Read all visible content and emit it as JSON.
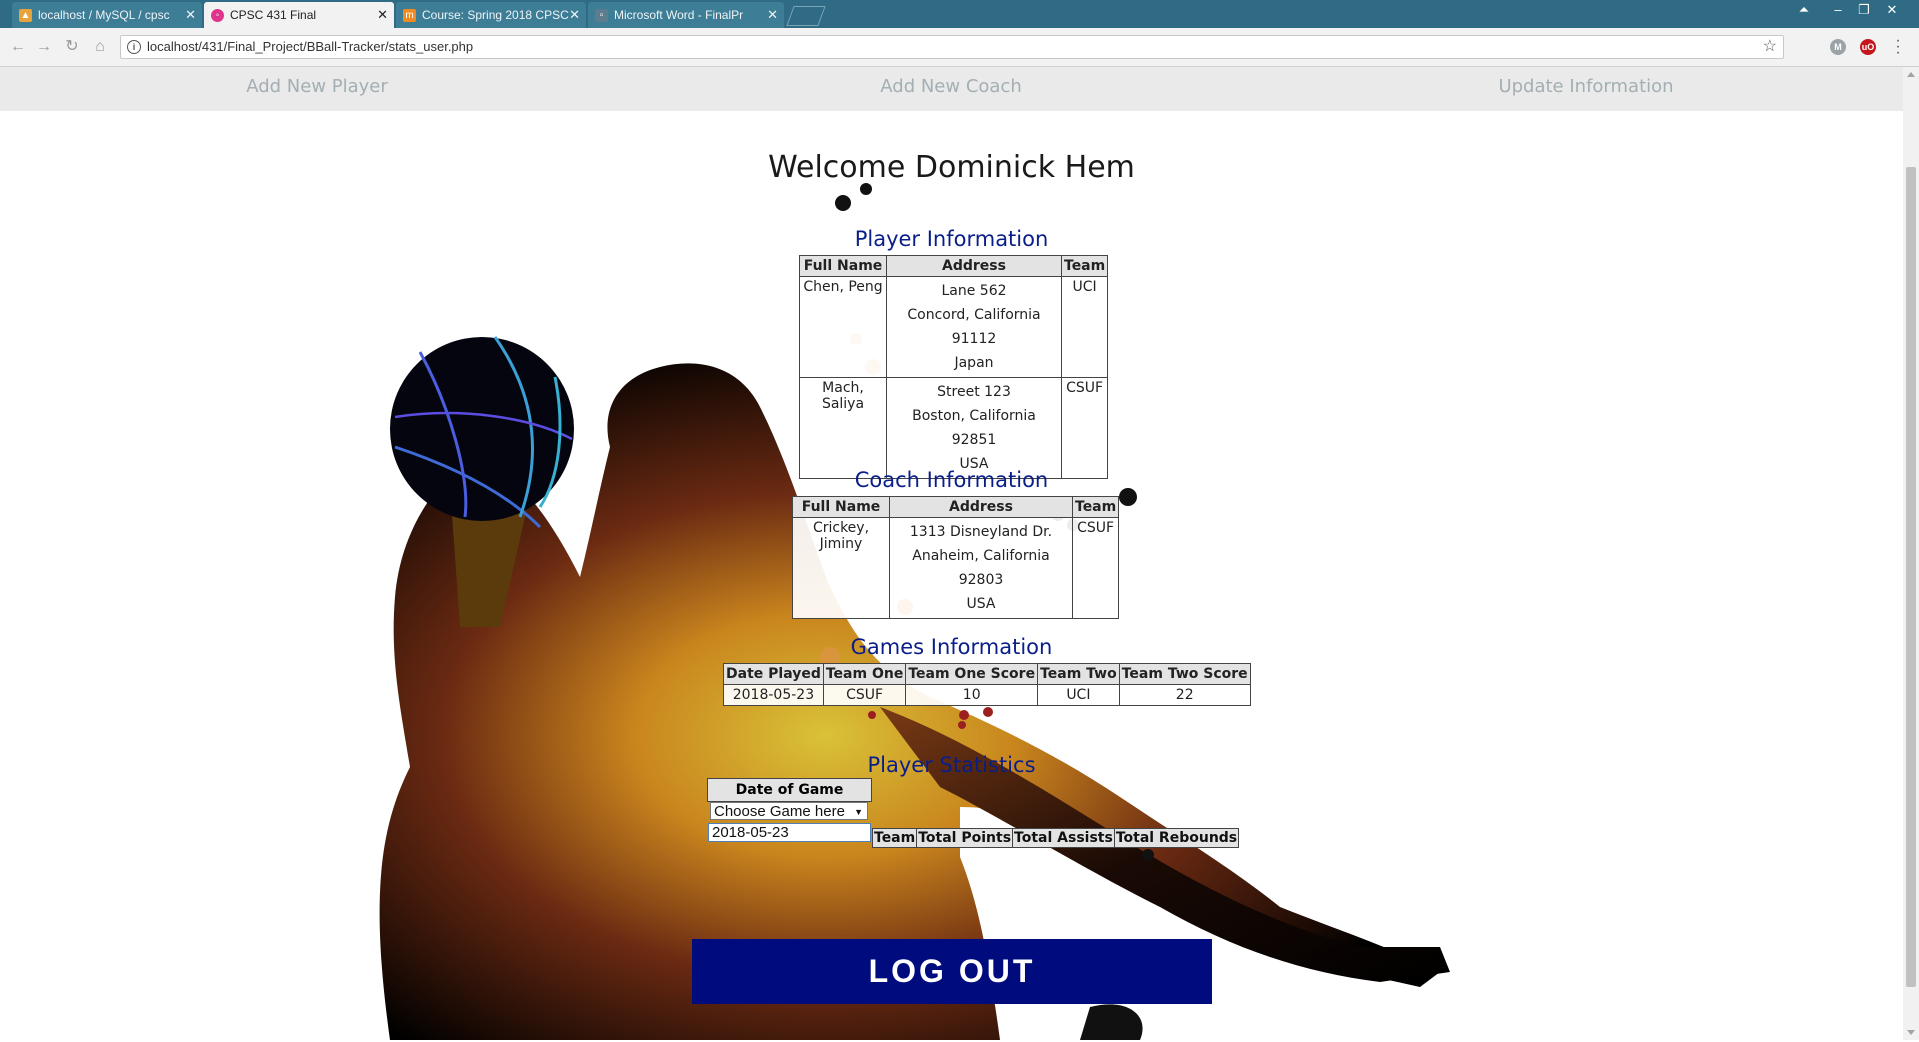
{
  "browser": {
    "tabs": [
      {
        "title": "localhost / MySQL / cpsc",
        "favicon": "phpmyadmin-icon",
        "active": false
      },
      {
        "title": "CPSC 431 Final",
        "favicon": "page-icon",
        "active": true
      },
      {
        "title": "Course: Spring 2018 CPSC",
        "favicon": "moodle-icon",
        "active": false
      },
      {
        "title": "Microsoft Word - FinalPr",
        "favicon": "document-icon",
        "active": false
      }
    ],
    "url": "localhost/431/Final_Project/BBall-Tracker/stats_user.php"
  },
  "nav": {
    "add_player": "Add New Player",
    "add_coach": "Add New Coach",
    "update_info": "Update Information"
  },
  "welcome": "Welcome Dominick Hem",
  "player_info": {
    "title": "Player Information",
    "headers": [
      "Full Name",
      "Address",
      "Team"
    ],
    "rows": [
      {
        "name": "Chen, Peng",
        "street": "Lane 562",
        "city": "Concord, California 91112",
        "country": "Japan",
        "team": "UCI"
      },
      {
        "name": "Mach, Saliya",
        "street": "Street 123",
        "city": "Boston, California 92851",
        "country": "USA",
        "team": "CSUF"
      }
    ]
  },
  "coach_info": {
    "title": "Coach Information",
    "headers": [
      "Full Name",
      "Address",
      "Team"
    ],
    "rows": [
      {
        "name": "Crickey, Jiminy",
        "street": "1313 Disneyland Dr.",
        "city": "Anaheim, California 92803",
        "country": "USA",
        "team": "CSUF"
      }
    ]
  },
  "games_info": {
    "title": "Games Information",
    "headers": [
      "Date Played",
      "Team One",
      "Team One Score",
      "Team Two",
      "Team Two Score"
    ],
    "rows": [
      {
        "date": "2018-05-23",
        "team_one": "CSUF",
        "team_one_score": "10",
        "team_two": "UCI",
        "team_two_score": "22"
      }
    ]
  },
  "player_stats": {
    "title": "Player Statistics",
    "date_header": "Date of Game",
    "select_placeholder": "Choose Game here",
    "dropdown_option": "2018-05-23",
    "columns": [
      "Team",
      "Total Points",
      "Total Assists",
      "Total Rebounds"
    ]
  },
  "logout_label": "LOG OUT"
}
